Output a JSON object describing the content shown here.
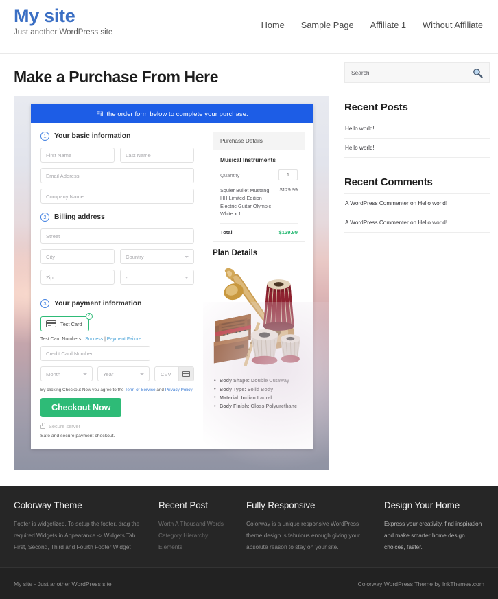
{
  "header": {
    "site_title": "My site",
    "tagline": "Just another WordPress site",
    "nav": [
      {
        "label": "Home"
      },
      {
        "label": "Sample Page"
      },
      {
        "label": "Affiliate 1"
      },
      {
        "label": "Without Affiliate"
      }
    ]
  },
  "main": {
    "page_title": "Make a Purchase From Here",
    "form": {
      "banner": "Fill the order form below to complete your purchase.",
      "steps": [
        {
          "num": "1",
          "label": "Your basic information"
        },
        {
          "num": "2",
          "label": "Billing address"
        },
        {
          "num": "3",
          "label": "Your payment information"
        }
      ],
      "basic": {
        "first_name_placeholder": "First Name",
        "last_name_placeholder": "Last Name",
        "email_placeholder": "Email Address",
        "company_placeholder": "Company Name"
      },
      "billing": {
        "street_placeholder": "Street",
        "city_placeholder": "City",
        "country_placeholder": "Country",
        "zip_placeholder": "Zip",
        "state_placeholder": "-"
      },
      "payment": {
        "card_option_label": "Test Card",
        "card_option_selected": true,
        "check_glyph": "✓",
        "test_card_prefix": "Test Card Numbers : ",
        "test_card_success": "Success",
        "test_card_sep": " | ",
        "test_card_failure": "Payment Failure",
        "card_number_placeholder": "Credit Card Number",
        "month_placeholder": "Month",
        "year_placeholder": "Year",
        "cvv_placeholder": "CVV"
      },
      "terms_prefix": "By clicking Checkout Now you agree to the ",
      "terms_link_1": "Term of Service",
      "terms_mid": " and ",
      "terms_link_2": "Privacy Policy",
      "checkout_label": "Checkout Now",
      "secure_server": "Secure server",
      "safe_note": "Safe and secure payment checkout."
    },
    "purchase_details": {
      "heading": "Purchase Details",
      "product": "Musical Instruments",
      "quantity_label": "Quantity",
      "quantity_value": "1",
      "item_name": "Squier Bullet Mustang HH Limited-Edition Electric Guitar Olympic White x 1",
      "item_price": "$129.99",
      "total_label": "Total",
      "total_value": "$129.99"
    },
    "plan": {
      "title": "Plan Details",
      "image_name": "musical-instruments-photo",
      "specs": [
        "Body Shape: Double Cutaway",
        "Body Type: Solid Body",
        "Material: Indian Laurel",
        "Body Finish: Gloss Polyurethane"
      ]
    }
  },
  "sidebar": {
    "search": {
      "placeholder": "Search",
      "icon": "search-icon"
    },
    "widgets": [
      {
        "title": "Recent Posts",
        "items": [
          "Hello world!",
          "Hello world!"
        ]
      },
      {
        "title": "Recent Comments",
        "items": [
          "A WordPress Commenter on Hello world!",
          "A WordPress Commenter on Hello world!"
        ]
      }
    ]
  },
  "footer": {
    "columns": [
      {
        "title": "Colorway Theme",
        "text": "Footer is widgetized. To setup the footer, drag the required Widgets in Appearance -> Widgets Tab First, Second, Third and Fourth Footer Widget"
      },
      {
        "title": "Recent Post",
        "items": [
          "Worth A Thousand Words",
          "Category Hierarchy",
          "Elements"
        ]
      },
      {
        "title": "Fully Responsive",
        "text": "Colorway is a unique responsive WordPress theme design is fabulous enough giving your absolute reason to stay on your site."
      },
      {
        "title": "Design Your Home",
        "text": "Express your creativity, find inspiration and make smarter home design choices, faster."
      }
    ],
    "credit_left": "My site - Just another WordPress site",
    "credit_right": "Colorway WordPress Theme by InkThemes.com"
  },
  "colors": {
    "brand_blue": "#3b6fc4",
    "banner_blue": "#1d5de6",
    "accent_green": "#2ebb77",
    "footer_dark": "#262626",
    "credit_dark": "#222222",
    "link_blue": "#4aa3d8"
  }
}
